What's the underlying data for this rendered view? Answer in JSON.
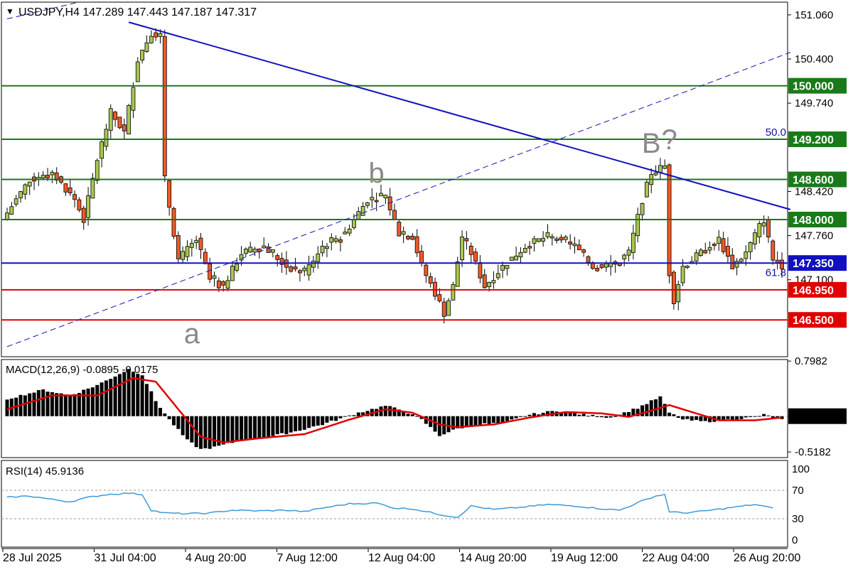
{
  "header": {
    "symbol_line": "USDJPY,H4  147.289 147.443 147.187 147.317"
  },
  "chart_data": [
    {
      "type": "candlestick",
      "title": "USDJPY,H4",
      "ohlc_last": {
        "open": 147.289,
        "high": 147.443,
        "low": 147.187,
        "close": 147.317
      },
      "ylim": [
        145.95,
        151.25
      ],
      "price_axis_ticks": [
        "151.060",
        "150.400",
        "149.740",
        "148.420",
        "147.760",
        "147.100"
      ],
      "x_tick_labels": [
        "28 Jul 2025",
        "31 Jul 04:00",
        "4 Aug 20:00",
        "7 Aug 12:00",
        "12 Aug 04:00",
        "14 Aug 20:00",
        "19 Aug 12:00",
        "22 Aug 04:00",
        "26 Aug 20:00"
      ],
      "close_path": [
        [
          0,
          148.1
        ],
        [
          5,
          148.6
        ],
        [
          10,
          148.7
        ],
        [
          15,
          148.3
        ],
        [
          17,
          148.0
        ],
        [
          20,
          148.9
        ],
        [
          23,
          149.6
        ],
        [
          26,
          149.3
        ],
        [
          29,
          150.4
        ],
        [
          32,
          150.8
        ],
        [
          34,
          150.75
        ],
        [
          35,
          148.6
        ],
        [
          38,
          147.4
        ],
        [
          42,
          147.7
        ],
        [
          45,
          147.1
        ],
        [
          48,
          147.0
        ],
        [
          52,
          147.5
        ],
        [
          57,
          147.6
        ],
        [
          62,
          147.3
        ],
        [
          66,
          147.2
        ],
        [
          70,
          147.6
        ],
        [
          75,
          147.8
        ],
        [
          80,
          148.3
        ],
        [
          84,
          148.35
        ],
        [
          87,
          147.8
        ],
        [
          90,
          147.75
        ],
        [
          92,
          147.3
        ],
        [
          95,
          146.9
        ],
        [
          97,
          146.6
        ],
        [
          99,
          147.0
        ],
        [
          101,
          147.75
        ],
        [
          103,
          147.5
        ],
        [
          106,
          147.0
        ],
        [
          110,
          147.3
        ],
        [
          115,
          147.6
        ],
        [
          120,
          147.75
        ],
        [
          126,
          147.6
        ],
        [
          130,
          147.3
        ],
        [
          135,
          147.35
        ],
        [
          138,
          147.5
        ],
        [
          141,
          148.3
        ],
        [
          143,
          148.7
        ],
        [
          146,
          148.8
        ],
        [
          147,
          147.2
        ],
        [
          148,
          146.8
        ],
        [
          150,
          147.3
        ],
        [
          154,
          147.5
        ],
        [
          158,
          147.7
        ],
        [
          161,
          147.3
        ],
        [
          164,
          147.5
        ],
        [
          167,
          147.9
        ],
        [
          168,
          148.0
        ],
        [
          170,
          147.4
        ],
        [
          172,
          147.32
        ]
      ],
      "horizontal_levels": [
        {
          "price": 150.0,
          "label": "150.000",
          "color": "#1a7a1a"
        },
        {
          "price": 149.2,
          "label": "149.200",
          "color": "#1a7a1a"
        },
        {
          "price": 148.6,
          "label": "148.600",
          "color": "#1a7a1a"
        },
        {
          "price": 148.0,
          "label": "148.000",
          "color": "#1a7a1a"
        },
        {
          "price": 147.35,
          "label": "147.350",
          "color": "#1010c0"
        },
        {
          "price": 146.95,
          "label": "146.950",
          "color": "#e00000"
        },
        {
          "price": 146.5,
          "label": "146.500",
          "color": "#e00000"
        }
      ],
      "fib_labels": [
        {
          "text": "50.0",
          "price": 149.2
        },
        {
          "text": "61.8",
          "price": 147.1
        }
      ],
      "wave_labels": [
        {
          "text": "a",
          "bar": 41,
          "price": 146.15
        },
        {
          "text": "b",
          "bar": 82,
          "price": 148.55
        },
        {
          "text": "B",
          "bar": 143,
          "price": 149.0
        },
        {
          "text": "?",
          "bar": 147,
          "price": 149.05
        }
      ],
      "trendlines": [
        {
          "from": [
            27,
            150.95
          ],
          "to": [
            172,
            148.15
          ],
          "style": "solid",
          "color": "#1010c0"
        },
        {
          "from": [
            0,
            146.1
          ],
          "to": [
            172,
            150.5
          ],
          "style": "dashed",
          "color": "#1010c0"
        },
        {
          "from": [
            0,
            151.0
          ],
          "to": [
            14,
            151.25
          ],
          "style": "dashed",
          "color": "#1010c0"
        }
      ],
      "colors": {
        "up": "#a8c850",
        "down": "#f05a28",
        "grid": "#ffffff"
      }
    },
    {
      "type": "bar",
      "title": "MACD(12,26,9) -0.0895 -0.0175",
      "ylim": [
        -0.6,
        0.82
      ],
      "axis_ticks": [
        "0.7982",
        "0.00",
        "-0.5182"
      ],
      "histogram_path": [
        [
          0,
          0.25
        ],
        [
          8,
          0.38
        ],
        [
          14,
          0.3
        ],
        [
          20,
          0.45
        ],
        [
          27,
          0.68
        ],
        [
          30,
          0.6
        ],
        [
          33,
          0.22
        ],
        [
          36,
          -0.05
        ],
        [
          40,
          -0.35
        ],
        [
          43,
          -0.48
        ],
        [
          46,
          -0.45
        ],
        [
          52,
          -0.35
        ],
        [
          58,
          -0.3
        ],
        [
          64,
          -0.22
        ],
        [
          70,
          -0.12
        ],
        [
          78,
          0.05
        ],
        [
          84,
          0.15
        ],
        [
          88,
          0.08
        ],
        [
          92,
          -0.05
        ],
        [
          96,
          -0.28
        ],
        [
          100,
          -0.18
        ],
        [
          104,
          -0.12
        ],
        [
          110,
          -0.1
        ],
        [
          116,
          0.02
        ],
        [
          122,
          0.08
        ],
        [
          128,
          0.02
        ],
        [
          134,
          -0.02
        ],
        [
          140,
          0.12
        ],
        [
          145,
          0.28
        ],
        [
          147,
          0.05
        ],
        [
          150,
          -0.05
        ],
        [
          155,
          -0.08
        ],
        [
          160,
          -0.05
        ],
        [
          165,
          -0.02
        ],
        [
          168,
          0.02
        ],
        [
          172,
          -0.05
        ]
      ],
      "signal_path": [
        [
          0,
          0.1
        ],
        [
          10,
          0.3
        ],
        [
          20,
          0.3
        ],
        [
          28,
          0.55
        ],
        [
          33,
          0.5
        ],
        [
          38,
          0.1
        ],
        [
          43,
          -0.3
        ],
        [
          48,
          -0.38
        ],
        [
          56,
          -0.32
        ],
        [
          66,
          -0.26
        ],
        [
          76,
          -0.05
        ],
        [
          84,
          0.1
        ],
        [
          90,
          0.05
        ],
        [
          96,
          -0.12
        ],
        [
          100,
          -0.16
        ],
        [
          108,
          -0.12
        ],
        [
          116,
          -0.02
        ],
        [
          124,
          0.06
        ],
        [
          132,
          0.04
        ],
        [
          138,
          -0.01
        ],
        [
          143,
          0.08
        ],
        [
          147,
          0.16
        ],
        [
          152,
          0.06
        ],
        [
          158,
          -0.06
        ],
        [
          166,
          -0.06
        ],
        [
          172,
          -0.02
        ]
      ],
      "colors": {
        "histogram": "#000000",
        "signal": "#e00000"
      }
    },
    {
      "type": "line",
      "title": "RSI(14) 45.9136",
      "ylim": [
        0,
        100
      ],
      "axis_ticks": [
        "100",
        "70",
        "30",
        "0"
      ],
      "levels": [
        70,
        30
      ],
      "series": [
        {
          "values_path": [
            [
              0,
              60
            ],
            [
              5,
              62
            ],
            [
              10,
              57
            ],
            [
              14,
              54
            ],
            [
              18,
              60
            ],
            [
              22,
              64
            ],
            [
              27,
              66
            ],
            [
              30,
              64
            ],
            [
              32,
              42
            ],
            [
              35,
              38
            ],
            [
              40,
              37
            ],
            [
              45,
              38
            ],
            [
              50,
              42
            ],
            [
              56,
              41
            ],
            [
              62,
              42
            ],
            [
              66,
              40
            ],
            [
              70,
              45
            ],
            [
              76,
              51
            ],
            [
              82,
              52
            ],
            [
              86,
              45
            ],
            [
              90,
              44
            ],
            [
              96,
              36
            ],
            [
              100,
              32
            ],
            [
              103,
              48
            ],
            [
              108,
              43
            ],
            [
              114,
              46
            ],
            [
              120,
              50
            ],
            [
              126,
              48
            ],
            [
              132,
              44
            ],
            [
              136,
              42
            ],
            [
              141,
              55
            ],
            [
              144,
              62
            ],
            [
              146,
              64
            ],
            [
              147,
              40
            ],
            [
              150,
              38
            ],
            [
              155,
              41
            ],
            [
              160,
              45
            ],
            [
              166,
              50
            ],
            [
              169,
              46
            ],
            [
              172,
              45.9
            ]
          ]
        }
      ],
      "colors": {
        "line": "#3a9ad9"
      }
    }
  ]
}
